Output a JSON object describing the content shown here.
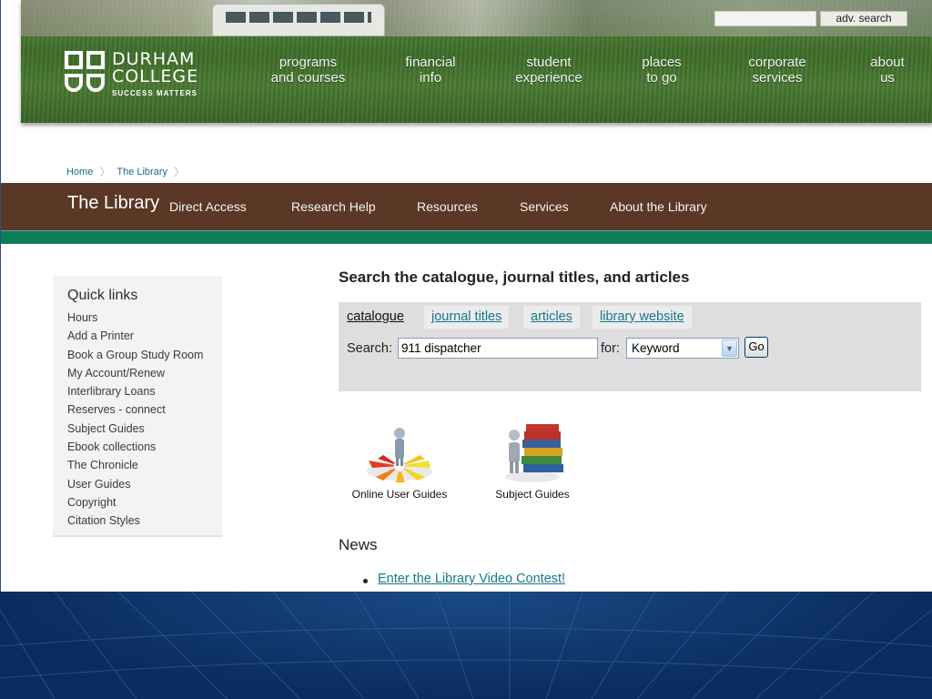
{
  "header": {
    "adv_search_label": "adv. search",
    "logo": {
      "line1": "DURHAM",
      "line2": "COLLEGE",
      "tagline": "SUCCESS MATTERS"
    },
    "nav": [
      {
        "line1": "programs",
        "line2": "and courses"
      },
      {
        "line1": "financial",
        "line2": "info"
      },
      {
        "line1": "student",
        "line2": "experience"
      },
      {
        "line1": "places",
        "line2": "to go"
      },
      {
        "line1": "corporate",
        "line2": "services"
      },
      {
        "line1": "about",
        "line2": "us"
      }
    ]
  },
  "breadcrumb": [
    "Home",
    "The Library"
  ],
  "library_bar": {
    "title": "The Library",
    "nav": [
      "Direct Access",
      "Research Help",
      "Resources",
      "Services",
      "About the Library"
    ]
  },
  "quick_links": {
    "title": "Quick links",
    "items": [
      "Hours",
      "Add a Printer",
      "Book a Group Study Room",
      "My Account/Renew",
      "Interlibrary Loans",
      "Reserves - connect",
      "Subject Guides",
      "Ebook collections",
      "The Chronicle",
      "User Guides",
      "Copyright",
      "Citation Styles"
    ]
  },
  "search": {
    "heading": "Search the catalogue, journal titles, and articles",
    "tabs": [
      "catalogue",
      "journal titles",
      "articles",
      "library website"
    ],
    "search_label": "Search:",
    "query": "911 dispatcher",
    "for_label": "for:",
    "type_selected": "Keyword",
    "go_label": "Go"
  },
  "guides": [
    "Online User Guides",
    "Subject Guides"
  ],
  "news": {
    "heading": "News",
    "items": [
      "Enter the Library Video Contest!"
    ]
  },
  "colors": {
    "library_bar": "#5b3826",
    "accent_green": "#0b7d59",
    "link": "#17788c",
    "slide_background": "#0d2f63"
  }
}
